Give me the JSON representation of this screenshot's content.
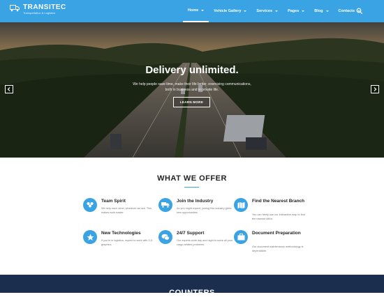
{
  "brand": {
    "name": "TRANSITEC",
    "tagline": "Transportation & Logistics",
    "accent_color": "#3aa3e3",
    "icon": "truck-icon"
  },
  "nav": {
    "items": [
      {
        "label": "Home",
        "active": true
      },
      {
        "label": "Vehicle Gallery"
      },
      {
        "label": "Services"
      },
      {
        "label": "Pages"
      },
      {
        "label": "Blog"
      },
      {
        "label": "Contacts"
      }
    ],
    "search_icon": "search-icon"
  },
  "hero": {
    "title": "Delivery unlimited.",
    "subtitle": "We help people save time, make their life better, exercising communications, both in business and in private life.",
    "button_label": "LEARN MORE",
    "prev_icon": "chevron-left-icon",
    "next_icon": "chevron-right-icon"
  },
  "offer": {
    "heading": "WHAT WE OFFER",
    "features": [
      {
        "title": "Team Spirit",
        "desc": "We help each other, wherever we are. This makes work easier.",
        "icon": "team-icon"
      },
      {
        "title": "Join the Industry",
        "desc": "As you might expect, joining this industry gives new opportunities.",
        "icon": "truck-icon"
      },
      {
        "title": "Find the Nearest Branch",
        "desc": "You can freely use our interactive map to find the nearest office.",
        "icon": "map-icon"
      },
      {
        "title": "New Technologies",
        "desc": "If you're in logistics, expect to work with 3-D graphics.",
        "icon": "star-icon"
      },
      {
        "title": "24/7 Support",
        "desc": "Our experts work day and night to solve all your cargo-related problems.",
        "icon": "chat-icon"
      },
      {
        "title": "Document Preparation",
        "desc": "Our document maintenance methodology is dependable.",
        "icon": "briefcase-icon"
      }
    ]
  },
  "counters": {
    "heading": "COUNTERS"
  }
}
